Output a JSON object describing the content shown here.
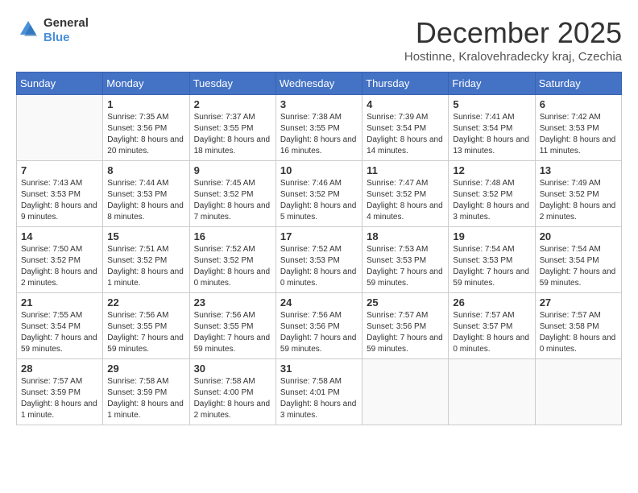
{
  "header": {
    "logo": {
      "general": "General",
      "blue": "Blue"
    },
    "title": "December 2025",
    "subtitle": "Hostinne, Kralovehradecky kraj, Czechia"
  },
  "days_of_week": [
    "Sunday",
    "Monday",
    "Tuesday",
    "Wednesday",
    "Thursday",
    "Friday",
    "Saturday"
  ],
  "weeks": [
    [
      {
        "day": "",
        "info": ""
      },
      {
        "day": "1",
        "info": "Sunrise: 7:35 AM\nSunset: 3:56 PM\nDaylight: 8 hours\nand 20 minutes."
      },
      {
        "day": "2",
        "info": "Sunrise: 7:37 AM\nSunset: 3:55 PM\nDaylight: 8 hours\nand 18 minutes."
      },
      {
        "day": "3",
        "info": "Sunrise: 7:38 AM\nSunset: 3:55 PM\nDaylight: 8 hours\nand 16 minutes."
      },
      {
        "day": "4",
        "info": "Sunrise: 7:39 AM\nSunset: 3:54 PM\nDaylight: 8 hours\nand 14 minutes."
      },
      {
        "day": "5",
        "info": "Sunrise: 7:41 AM\nSunset: 3:54 PM\nDaylight: 8 hours\nand 13 minutes."
      },
      {
        "day": "6",
        "info": "Sunrise: 7:42 AM\nSunset: 3:53 PM\nDaylight: 8 hours\nand 11 minutes."
      }
    ],
    [
      {
        "day": "7",
        "info": "Sunrise: 7:43 AM\nSunset: 3:53 PM\nDaylight: 8 hours\nand 9 minutes."
      },
      {
        "day": "8",
        "info": "Sunrise: 7:44 AM\nSunset: 3:53 PM\nDaylight: 8 hours\nand 8 minutes."
      },
      {
        "day": "9",
        "info": "Sunrise: 7:45 AM\nSunset: 3:52 PM\nDaylight: 8 hours\nand 7 minutes."
      },
      {
        "day": "10",
        "info": "Sunrise: 7:46 AM\nSunset: 3:52 PM\nDaylight: 8 hours\nand 5 minutes."
      },
      {
        "day": "11",
        "info": "Sunrise: 7:47 AM\nSunset: 3:52 PM\nDaylight: 8 hours\nand 4 minutes."
      },
      {
        "day": "12",
        "info": "Sunrise: 7:48 AM\nSunset: 3:52 PM\nDaylight: 8 hours\nand 3 minutes."
      },
      {
        "day": "13",
        "info": "Sunrise: 7:49 AM\nSunset: 3:52 PM\nDaylight: 8 hours\nand 2 minutes."
      }
    ],
    [
      {
        "day": "14",
        "info": "Sunrise: 7:50 AM\nSunset: 3:52 PM\nDaylight: 8 hours\nand 2 minutes."
      },
      {
        "day": "15",
        "info": "Sunrise: 7:51 AM\nSunset: 3:52 PM\nDaylight: 8 hours\nand 1 minute."
      },
      {
        "day": "16",
        "info": "Sunrise: 7:52 AM\nSunset: 3:52 PM\nDaylight: 8 hours\nand 0 minutes."
      },
      {
        "day": "17",
        "info": "Sunrise: 7:52 AM\nSunset: 3:53 PM\nDaylight: 8 hours\nand 0 minutes."
      },
      {
        "day": "18",
        "info": "Sunrise: 7:53 AM\nSunset: 3:53 PM\nDaylight: 7 hours\nand 59 minutes."
      },
      {
        "day": "19",
        "info": "Sunrise: 7:54 AM\nSunset: 3:53 PM\nDaylight: 7 hours\nand 59 minutes."
      },
      {
        "day": "20",
        "info": "Sunrise: 7:54 AM\nSunset: 3:54 PM\nDaylight: 7 hours\nand 59 minutes."
      }
    ],
    [
      {
        "day": "21",
        "info": "Sunrise: 7:55 AM\nSunset: 3:54 PM\nDaylight: 7 hours\nand 59 minutes."
      },
      {
        "day": "22",
        "info": "Sunrise: 7:56 AM\nSunset: 3:55 PM\nDaylight: 7 hours\nand 59 minutes."
      },
      {
        "day": "23",
        "info": "Sunrise: 7:56 AM\nSunset: 3:55 PM\nDaylight: 7 hours\nand 59 minutes."
      },
      {
        "day": "24",
        "info": "Sunrise: 7:56 AM\nSunset: 3:56 PM\nDaylight: 7 hours\nand 59 minutes."
      },
      {
        "day": "25",
        "info": "Sunrise: 7:57 AM\nSunset: 3:56 PM\nDaylight: 7 hours\nand 59 minutes."
      },
      {
        "day": "26",
        "info": "Sunrise: 7:57 AM\nSunset: 3:57 PM\nDaylight: 8 hours\nand 0 minutes."
      },
      {
        "day": "27",
        "info": "Sunrise: 7:57 AM\nSunset: 3:58 PM\nDaylight: 8 hours\nand 0 minutes."
      }
    ],
    [
      {
        "day": "28",
        "info": "Sunrise: 7:57 AM\nSunset: 3:59 PM\nDaylight: 8 hours\nand 1 minute."
      },
      {
        "day": "29",
        "info": "Sunrise: 7:58 AM\nSunset: 3:59 PM\nDaylight: 8 hours\nand 1 minute."
      },
      {
        "day": "30",
        "info": "Sunrise: 7:58 AM\nSunset: 4:00 PM\nDaylight: 8 hours\nand 2 minutes."
      },
      {
        "day": "31",
        "info": "Sunrise: 7:58 AM\nSunset: 4:01 PM\nDaylight: 8 hours\nand 3 minutes."
      },
      {
        "day": "",
        "info": ""
      },
      {
        "day": "",
        "info": ""
      },
      {
        "day": "",
        "info": ""
      }
    ]
  ]
}
